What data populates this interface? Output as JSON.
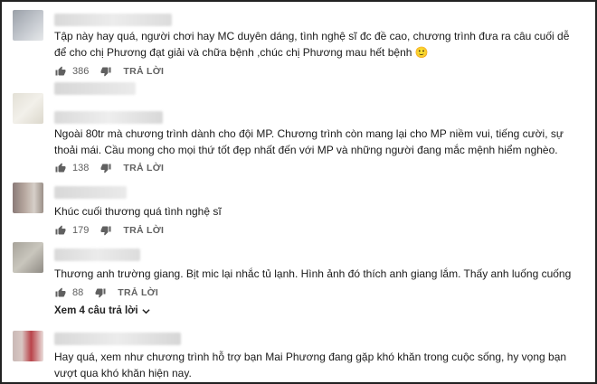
{
  "comments": [
    {
      "text": "Tập này hay quá, người chơi hay MC duyên dáng, tình nghệ sĩ đc đề cao, chương trình đưa ra câu cuối dễ để cho chị Phương đạt giải và chữa bệnh ,chúc chị Phương mau hết bệnh 🙂",
      "likes": "386",
      "reply_label": "TRẢ LỜI"
    },
    {
      "text": "Ngoài 80tr mà chương trình dành cho đội MP. Chương trình còn mang lại cho MP niềm vui, tiếng cười, sự thoải mái. Cầu mong cho mọi thứ tốt đẹp nhất đến với MP và những người đang mắc mệnh hiểm nghèo.",
      "likes": "138",
      "reply_label": "TRẢ LỜI"
    },
    {
      "text": "Khúc cuối thương quá tình nghệ sĩ",
      "likes": "179",
      "reply_label": "TRẢ LỜI"
    },
    {
      "text": "Thương anh trường giang. Bịt mic lại nhắc tủ lạnh.  Hình ảnh đó thích anh giang lắm. Thấy anh luống cuống",
      "likes": "88",
      "reply_label": "TRẢ LỜI",
      "replies_toggle": "Xem 4 câu trả lời"
    },
    {
      "text": "Hay quá, xem như chương trình hỗ trợ bạn Mai Phương đang gặp khó khăn trong cuộc sống, hy vọng bạn  vượt qua khó khăn hiện nay."
    }
  ],
  "icons": {
    "like": "thumbs-up-icon",
    "dislike": "thumbs-down-icon",
    "expand": "chevron-down-icon"
  },
  "colors": {
    "text": "#1a1a1a",
    "meta": "#606060"
  }
}
